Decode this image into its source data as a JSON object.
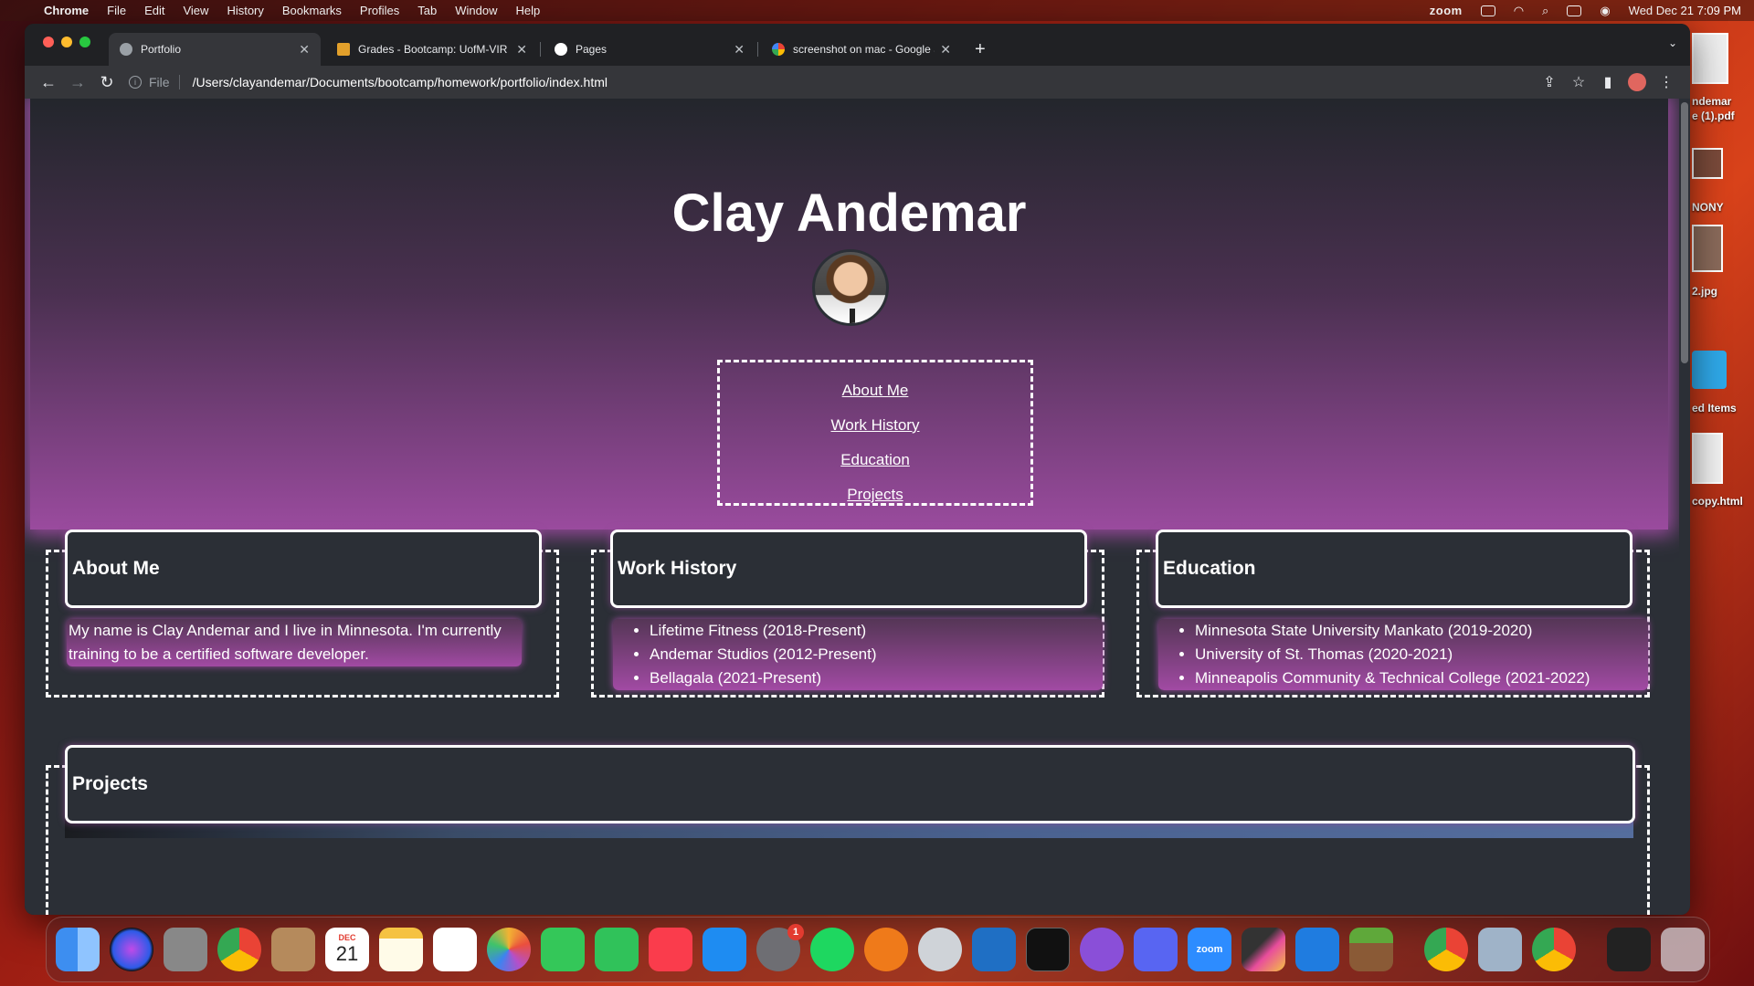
{
  "menubar": {
    "app": "Chrome",
    "items": [
      "File",
      "Edit",
      "View",
      "History",
      "Bookmarks",
      "Profiles",
      "Tab",
      "Window",
      "Help"
    ],
    "zoom": "zoom",
    "clock": "Wed Dec 21  7:09 PM"
  },
  "desktop": {
    "items": [
      "ndemar",
      "e (1).pdf",
      "NONY",
      "2.jpg",
      "ed Items",
      "copy.html"
    ]
  },
  "tabs": [
    {
      "title": "Portfolio",
      "icon": "globe-icon",
      "active": true
    },
    {
      "title": "Grades - Bootcamp: UofM-VIR",
      "icon": "canvas-icon"
    },
    {
      "title": "Pages",
      "icon": "github-icon"
    },
    {
      "title": "screenshot on mac - Google S",
      "icon": "google-icon"
    }
  ],
  "address": {
    "scheme": "File",
    "url": "/Users/clayandemar/Documents/bootcamp/homework/portfolio/index.html"
  },
  "page": {
    "name": "Clay Andemar",
    "nav": [
      "About Me",
      "Work History",
      "Education",
      "Projects"
    ],
    "about": {
      "heading": "About Me",
      "text": "My name is Clay Andemar and I live in Minnesota. I'm currently training to be a certified software developer."
    },
    "work": {
      "heading": "Work History",
      "items": [
        "Lifetime Fitness (2018-Present)",
        "Andemar Studios (2012-Present)",
        "Bellagala (2021-Present)"
      ]
    },
    "education": {
      "heading": "Education",
      "items": [
        "Minnesota State University Mankato (2019-2020)",
        "University of St. Thomas (2020-2021)",
        "Minneapolis Community & Technical College (2021-2022)"
      ]
    },
    "projects": {
      "heading": "Projects"
    }
  },
  "dock": {
    "calendar_month": "DEC",
    "calendar_day": "21",
    "settings_badge": "1",
    "zoom_label": "zoom"
  },
  "colors": {
    "accent": "#9a4b9e",
    "page_bg": "#2b2f36"
  }
}
